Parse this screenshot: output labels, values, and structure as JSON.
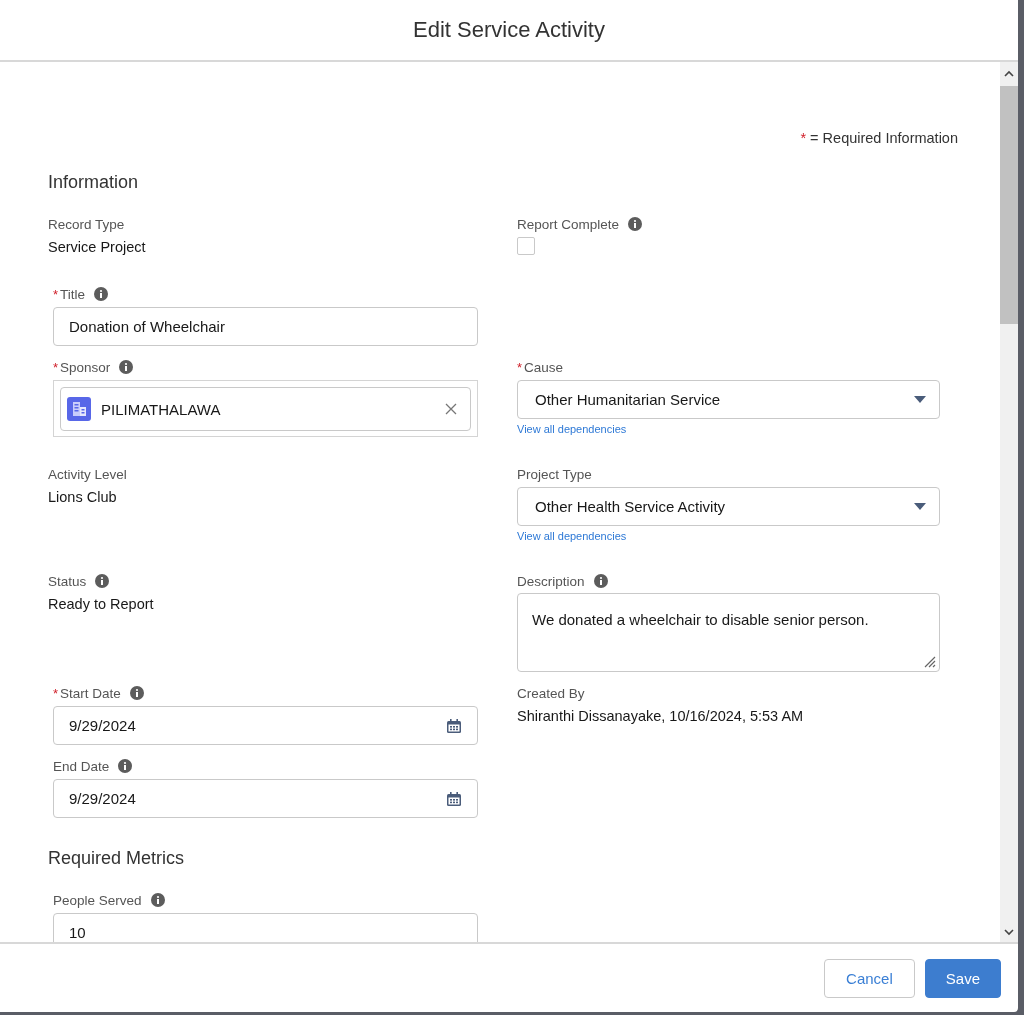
{
  "modal": {
    "title": "Edit Service Activity"
  },
  "required_marker": "*",
  "required_note": "= Required Information",
  "sections": [
    {
      "heading": "Information",
      "rows": [
        {
          "left": {
            "kind": "readonly",
            "label": "Record Type",
            "value": "Service Project"
          },
          "right": {
            "kind": "checkbox",
            "label": "Report Complete",
            "info": true,
            "checked": false
          }
        },
        {
          "left": {
            "kind": "text",
            "label": "Title",
            "required": true,
            "info": true,
            "value": "Donation of Wheelchair"
          }
        },
        {
          "left": {
            "kind": "lookup",
            "label": "Sponsor",
            "required": true,
            "info": true,
            "value": "PILIMATHALAWA"
          },
          "right": {
            "kind": "picklist",
            "label": "Cause",
            "required": true,
            "value": "Other Humanitarian Service",
            "link": "View all dependencies"
          }
        },
        {
          "left": {
            "kind": "readonly",
            "label": "Activity Level",
            "value": "Lions Club"
          },
          "right": {
            "kind": "picklist",
            "label": "Project Type",
            "value": "Other Health Service Activity",
            "link": "View all dependencies"
          }
        },
        {
          "left": {
            "kind": "readonly",
            "label": "Status",
            "info": true,
            "value": "Ready to Report"
          },
          "right": {
            "kind": "textarea",
            "label": "Description",
            "info": true,
            "value": "We donated a wheelchair to disable senior person."
          }
        },
        {
          "left": {
            "kind": "date",
            "label": "Start Date",
            "required": true,
            "info": true,
            "value": "9/29/2024"
          },
          "right": {
            "kind": "readonly",
            "label": "Created By",
            "value": "Shiranthi Dissanayake, 10/16/2024, 5:53 AM"
          }
        },
        {
          "left": {
            "kind": "date",
            "label": "End Date",
            "info": true,
            "value": "9/29/2024"
          }
        }
      ]
    },
    {
      "heading": "Required Metrics",
      "rows": [
        {
          "left": {
            "kind": "text",
            "label": "People Served",
            "info": true,
            "value": "10"
          }
        }
      ]
    }
  ],
  "footer": {
    "buttons": [
      {
        "label": "Cancel",
        "kind": "neutral"
      },
      {
        "label": "Save",
        "kind": "brand"
      }
    ]
  }
}
